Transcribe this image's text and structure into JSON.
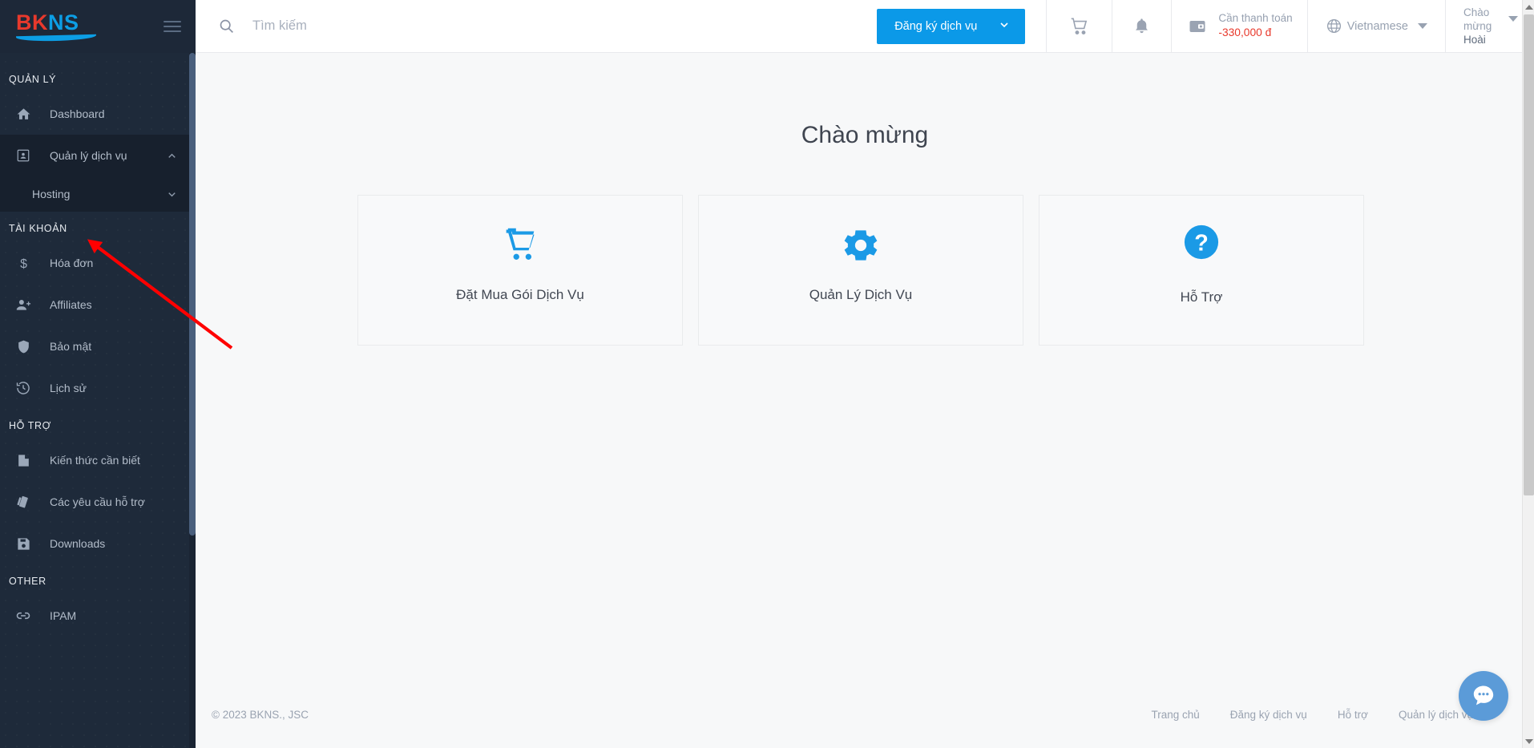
{
  "brand": {
    "name_part1": "BK",
    "name_part2": "NS",
    "full": "BKNS"
  },
  "sidebar": {
    "sections": [
      {
        "label": "QUẢN LÝ"
      },
      {
        "label": "TÀI KHOẢN"
      },
      {
        "label": "HỖ TRỢ"
      },
      {
        "label": "OTHER"
      }
    ],
    "items": {
      "dashboard": "Dashboard",
      "service_management": "Quản lý dịch vụ",
      "hosting": "Hosting",
      "invoice": "Hóa đơn",
      "affiliates": "Affiliates",
      "security": "Bảo mật",
      "history": "Lịch sử",
      "knowledge": "Kiến thức cần biết",
      "support_requests": "Các yêu cầu hỗ trợ",
      "downloads": "Downloads",
      "ipam": "IPAM"
    }
  },
  "topbar": {
    "search_placeholder": "Tìm kiếm",
    "search_value": "",
    "register_button": "Đăng ký dịch vụ",
    "payment_label": "Cần thanh toán",
    "payment_amount": "-330,000 đ",
    "language": "Vietnamese",
    "greeting": "Chào mừng",
    "user_name": "Hoài"
  },
  "main": {
    "welcome_title": "Chào mừng",
    "cards": [
      {
        "label": "Đặt Mua Gói Dịch Vụ",
        "icon": "cart-icon"
      },
      {
        "label": "Quản Lý Dịch Vụ",
        "icon": "gear-icon"
      },
      {
        "label": "Hỗ Trợ",
        "icon": "question-icon"
      }
    ]
  },
  "footer": {
    "copyright": "© 2023 BKNS., JSC",
    "links": [
      "Trang chủ",
      "Đăng ký dịch vụ",
      "Hỗ trợ",
      "Quản lý dịch vụ"
    ]
  },
  "colors": {
    "accent": "#0b99e8",
    "sidebar_bg": "#1e2a3a",
    "danger": "#e8392c",
    "logo_blue": "#0c9ee5",
    "annotation_arrow": "#ff0000"
  }
}
